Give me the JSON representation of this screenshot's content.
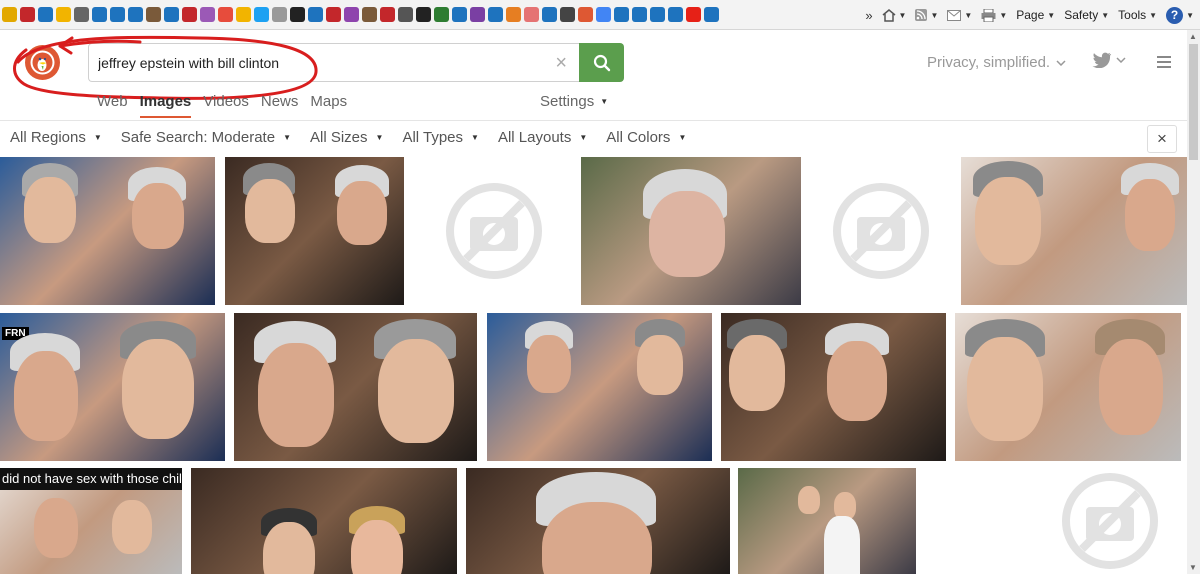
{
  "ie_toolbar": {
    "page_label": "Page",
    "safety_label": "Safety",
    "tools_label": "Tools",
    "help_label": "?",
    "favorites": [
      {
        "icon": "star-icon",
        "color": "#e2a800"
      },
      {
        "icon": "news-icon",
        "color": "#c3272b"
      },
      {
        "icon": "ie-icon",
        "color": "#1e73be"
      },
      {
        "icon": "bulb-icon",
        "color": "#f2b400"
      },
      {
        "icon": "clip-icon",
        "color": "#666666"
      },
      {
        "icon": "ie-icon",
        "color": "#1e73be"
      },
      {
        "icon": "play-icon",
        "color": "#1e73be"
      },
      {
        "icon": "ie-icon",
        "color": "#1e73be"
      },
      {
        "icon": "circle-icon",
        "color": "#7a5a3a"
      },
      {
        "icon": "ie-icon",
        "color": "#1e73be"
      },
      {
        "icon": "k-icon",
        "color": "#c3272b"
      },
      {
        "icon": "v-icon",
        "color": "#9b59b6"
      },
      {
        "icon": "box-icon",
        "color": "#e74c3c"
      },
      {
        "icon": "smile-icon",
        "color": "#f2b400"
      },
      {
        "icon": "twitter-icon",
        "color": "#1da1f2"
      },
      {
        "icon": "link-icon",
        "color": "#999999"
      },
      {
        "icon": "q-icon",
        "color": "#222222"
      },
      {
        "icon": "ie-icon",
        "color": "#1e73be"
      },
      {
        "icon": "m-icon",
        "color": "#c3272b"
      },
      {
        "icon": "grid-icon",
        "color": "#8e44ad"
      },
      {
        "icon": "antler-icon",
        "color": "#7a5a3a"
      },
      {
        "icon": "speech-icon",
        "color": "#c3272b"
      },
      {
        "icon": "question-icon",
        "color": "#555555"
      },
      {
        "icon": "square-icon",
        "color": "#222222"
      },
      {
        "icon": "globe-icon",
        "color": "#2e7d32"
      },
      {
        "icon": "mail-icon",
        "color": "#1e73be"
      },
      {
        "icon": "m-icon",
        "color": "#7a3fa3"
      },
      {
        "icon": "mail-icon",
        "color": "#1e73be"
      },
      {
        "icon": "ja-icon",
        "color": "#e67e22"
      },
      {
        "icon": "target-icon",
        "color": "#e57373"
      },
      {
        "icon": "ie-icon",
        "color": "#1e73be"
      },
      {
        "icon": "w-icon",
        "color": "#444444"
      },
      {
        "icon": "duck-icon",
        "color": "#de5833"
      },
      {
        "icon": "google-icon",
        "color": "#4285f4"
      },
      {
        "icon": "ie-icon",
        "color": "#1e73be"
      },
      {
        "icon": "ie-icon",
        "color": "#1e73be"
      },
      {
        "icon": "ie-icon",
        "color": "#1e73be"
      },
      {
        "icon": "ie-icon",
        "color": "#1e73be"
      },
      {
        "icon": "youtube-icon",
        "color": "#e62117"
      },
      {
        "icon": "ie-icon",
        "color": "#1e73be"
      }
    ]
  },
  "search": {
    "query": "jeffrey epstein with bill clinton",
    "clear_label": "×"
  },
  "header": {
    "tagline": "Privacy, simplified."
  },
  "nav": {
    "tabs": [
      "Web",
      "Images",
      "Videos",
      "News",
      "Maps"
    ],
    "active": "Images",
    "settings_label": "Settings"
  },
  "filters": {
    "items": [
      "All Regions",
      "Safe Search: Moderate",
      "All Sizes",
      "All Types",
      "All Layouts",
      "All Colors"
    ],
    "close_label": "×"
  },
  "results": {
    "row3_caption": "did not have sex with those children.",
    "fr_badge": "FRN"
  },
  "colors": {
    "brand": "#de5833",
    "search_button": "#5b9e4d",
    "annotation": "#d81e1e"
  }
}
